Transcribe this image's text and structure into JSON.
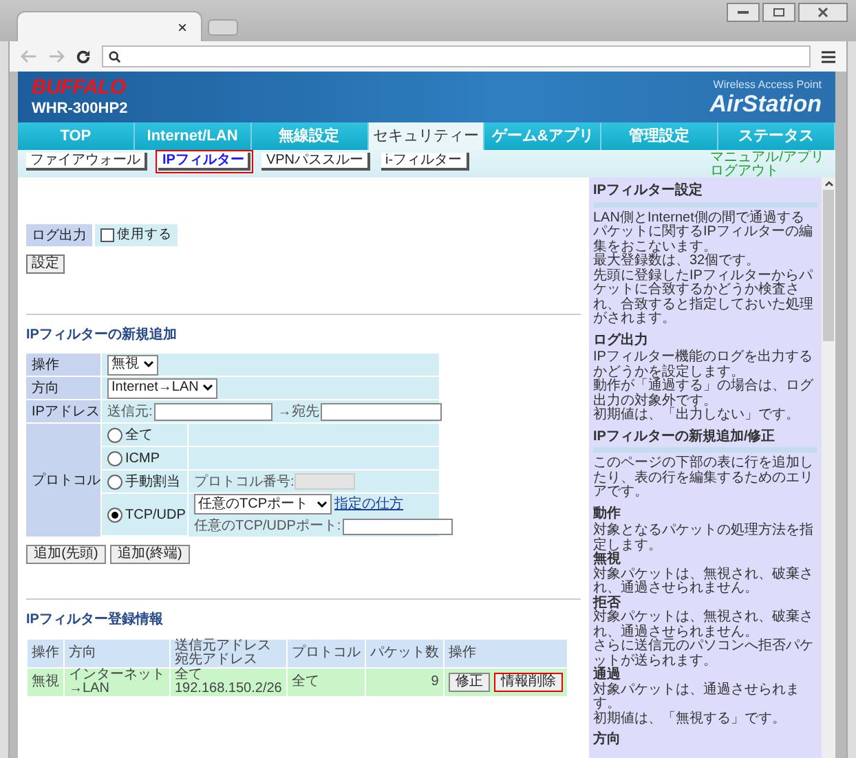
{
  "browser": {
    "tab_close": "×"
  },
  "header": {
    "brand": "BUFFALO",
    "model": "WHR-300HP2",
    "tagline": "Wireless Access Point",
    "product": "AirStation"
  },
  "nav_tabs": [
    {
      "label": "TOP",
      "selected": false
    },
    {
      "label": "Internet/LAN",
      "selected": false
    },
    {
      "label": "無線設定",
      "selected": false
    },
    {
      "label": "セキュリティー",
      "selected": true
    },
    {
      "label": "ゲーム&アプリ",
      "selected": false
    },
    {
      "label": "管理設定",
      "selected": false
    },
    {
      "label": "ステータス",
      "selected": false
    }
  ],
  "sub_tabs": [
    {
      "label": "ファイアウォール",
      "selected": false,
      "highlighted": false
    },
    {
      "label": "IPフィルター",
      "selected": true,
      "highlighted": true
    },
    {
      "label": "VPNパススルー",
      "selected": false,
      "highlighted": false
    },
    {
      "label": "i-フィルター",
      "selected": false,
      "highlighted": false
    }
  ],
  "top_links": [
    "マニュアル/アプリ",
    "ログアウト"
  ],
  "log_output": {
    "label": "ログ出力",
    "option": "使用する",
    "checked": false,
    "button": "設定"
  },
  "new_filter": {
    "title": "IPフィルターの新規追加",
    "action": {
      "label": "操作",
      "value": "無視"
    },
    "direction": {
      "label": "方向",
      "value": "Internet→LAN"
    },
    "ip": {
      "label": "IPアドレス",
      "source_label": "送信元:",
      "dest_label": "→宛先"
    },
    "protocol": {
      "label": "プロトコル",
      "options": [
        {
          "kind": "plain",
          "label": "全て",
          "selected": false
        },
        {
          "kind": "plain",
          "label": "ICMP",
          "selected": false
        },
        {
          "kind": "number",
          "label": "手動割当",
          "selected": false,
          "field_label": "プロトコル番号:",
          "disabled": true
        },
        {
          "kind": "port",
          "label": "TCP/UDP",
          "selected": true,
          "port_select": "任意のTCPポート",
          "help_link": "指定の仕方",
          "field_label": "任意のTCP/UDPポート:"
        }
      ]
    },
    "buttons": [
      "追加(先頭)",
      "追加(終端)"
    ]
  },
  "registered": {
    "title": "IPフィルター登録情報",
    "columns": [
      "操作",
      "方向",
      "送信元アドレス宛先アドレス",
      "プロトコル",
      "パケット数",
      "操作"
    ],
    "rows": [
      {
        "cells": [
          "無視",
          "インターネット →LAN",
          "全て 192.168.150.2/26",
          "全て",
          "9"
        ],
        "buttons": [
          {
            "label": "修正",
            "highlighted": false
          },
          {
            "label": "情報削除",
            "highlighted": true
          }
        ]
      }
    ]
  },
  "help": [
    {
      "title": "IPフィルター設定",
      "bar": true,
      "blocks": [
        {
          "kind": "text",
          "text": "LAN側とInternet側の間で通過するパケットに関するIPフィルターの編集をおこないます。"
        },
        {
          "kind": "text",
          "text": "最大登録数は、32個です。"
        },
        {
          "kind": "text",
          "text": "先頭に登録したIPフィルターからパケットに合致するかどうか検査され、合致すると指定しておいた処理がされます。"
        }
      ]
    },
    {
      "title": "ログ出力",
      "bar": false,
      "blocks": [
        {
          "kind": "text",
          "text": "IPフィルター機能のログを出力するかどうかを設定します。"
        },
        {
          "kind": "text",
          "text": "動作が「通過する」の場合は、ログ出力の対象外です。"
        },
        {
          "kind": "text",
          "text": "初期値は、「出力しない」です。"
        }
      ]
    },
    {
      "title": "IPフィルターの新規追加/修正",
      "bar": true,
      "blocks": [
        {
          "kind": "text",
          "text": "このページの下部の表に行を追加したり、表の行を編集するためのエリアです。"
        }
      ]
    },
    {
      "title": "動作",
      "bar": false,
      "blocks": [
        {
          "kind": "text",
          "text": "対象となるパケットの処理方法を指定します。"
        },
        {
          "kind": "term",
          "text": "無視"
        },
        {
          "kind": "text",
          "text": "対象パケットは、無視され、破棄され、通過させられません。"
        },
        {
          "kind": "term",
          "text": "拒否"
        },
        {
          "kind": "text",
          "text": "対象パケットは、無視され、破棄され、通過させられません。"
        },
        {
          "kind": "text",
          "text": "さらに送信元のパソコンへ拒否パケットが送られます。"
        },
        {
          "kind": "term",
          "text": "通過"
        },
        {
          "kind": "text",
          "text": "対象パケットは、通過させられます。"
        },
        {
          "kind": "text",
          "text": "初期値は、「無視する」です。"
        }
      ]
    },
    {
      "title": "方向",
      "bar": false
    }
  ]
}
